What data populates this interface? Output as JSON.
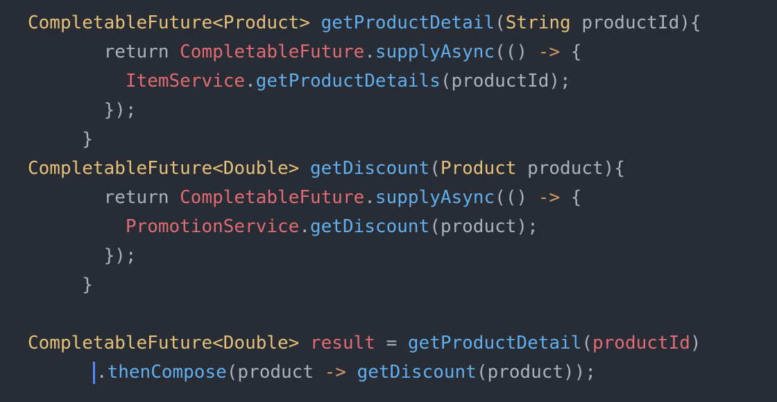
{
  "editor": {
    "theme_colors": {
      "background": "#282c34",
      "type": "#e5c07b",
      "function": "#61afef",
      "class_ref": "#e06c75",
      "punctuation": "#abb2bf",
      "cursor": "#528bff"
    },
    "lines": [
      {
        "indent": "",
        "tokens": [
          {
            "k": "type",
            "t": "CompletableFuture<Product>"
          },
          {
            "k": "plain",
            "t": " "
          },
          {
            "k": "fn",
            "t": "getProductDetail"
          },
          {
            "k": "punct",
            "t": "("
          },
          {
            "k": "type",
            "t": "String"
          },
          {
            "k": "plain",
            "t": " productId"
          },
          {
            "k": "punct",
            "t": "){"
          }
        ]
      },
      {
        "indent": "       ",
        "tokens": [
          {
            "k": "kw",
            "t": "return"
          },
          {
            "k": "plain",
            "t": " "
          },
          {
            "k": "cls",
            "t": "CompletableFuture"
          },
          {
            "k": "punct",
            "t": "."
          },
          {
            "k": "fn",
            "t": "supplyAsync"
          },
          {
            "k": "punct",
            "t": "(() "
          },
          {
            "k": "op",
            "t": "->"
          },
          {
            "k": "punct",
            "t": " {"
          }
        ]
      },
      {
        "indent": "         ",
        "tokens": [
          {
            "k": "cls",
            "t": "ItemService"
          },
          {
            "k": "punct",
            "t": "."
          },
          {
            "k": "fn",
            "t": "getProductDetails"
          },
          {
            "k": "punct",
            "t": "(productId);"
          }
        ]
      },
      {
        "indent": "       ",
        "tokens": [
          {
            "k": "punct",
            "t": "});"
          }
        ]
      },
      {
        "indent": "     ",
        "tokens": [
          {
            "k": "punct",
            "t": "}"
          }
        ]
      },
      {
        "indent": "",
        "tokens": [
          {
            "k": "type",
            "t": "CompletableFuture<Double>"
          },
          {
            "k": "plain",
            "t": " "
          },
          {
            "k": "fn",
            "t": "getDiscount"
          },
          {
            "k": "punct",
            "t": "("
          },
          {
            "k": "type",
            "t": "Product"
          },
          {
            "k": "plain",
            "t": " product"
          },
          {
            "k": "punct",
            "t": "){"
          }
        ]
      },
      {
        "indent": "       ",
        "tokens": [
          {
            "k": "kw",
            "t": "return"
          },
          {
            "k": "plain",
            "t": " "
          },
          {
            "k": "cls",
            "t": "CompletableFuture"
          },
          {
            "k": "punct",
            "t": "."
          },
          {
            "k": "fn",
            "t": "supplyAsync"
          },
          {
            "k": "punct",
            "t": "(() "
          },
          {
            "k": "op",
            "t": "->"
          },
          {
            "k": "punct",
            "t": " {"
          }
        ]
      },
      {
        "indent": "         ",
        "tokens": [
          {
            "k": "cls",
            "t": "PromotionService"
          },
          {
            "k": "punct",
            "t": "."
          },
          {
            "k": "fn",
            "t": "getDiscount"
          },
          {
            "k": "punct",
            "t": "(product);"
          }
        ]
      },
      {
        "indent": "       ",
        "tokens": [
          {
            "k": "punct",
            "t": "});"
          }
        ]
      },
      {
        "indent": "     ",
        "tokens": [
          {
            "k": "punct",
            "t": "}"
          }
        ]
      },
      {
        "indent": "",
        "tokens": [
          {
            "k": "type",
            "t": "CompletableFuture<Double>"
          },
          {
            "k": "plain",
            "t": " "
          },
          {
            "k": "var",
            "t": "result"
          },
          {
            "k": "plain",
            "t": " = "
          },
          {
            "k": "fn",
            "t": "getProductDetail"
          },
          {
            "k": "punct",
            "t": "("
          },
          {
            "k": "var",
            "t": "productId"
          },
          {
            "k": "punct",
            "t": ")"
          }
        ]
      },
      {
        "indent": "      ",
        "cursor": true,
        "tokens": [
          {
            "k": "punct",
            "t": "."
          },
          {
            "k": "fn",
            "t": "thenCompose"
          },
          {
            "k": "punct",
            "t": "(product "
          },
          {
            "k": "op",
            "t": "->"
          },
          {
            "k": "plain",
            "t": " "
          },
          {
            "k": "fn",
            "t": "getDiscount"
          },
          {
            "k": "punct",
            "t": "(product));"
          }
        ]
      }
    ]
  }
}
